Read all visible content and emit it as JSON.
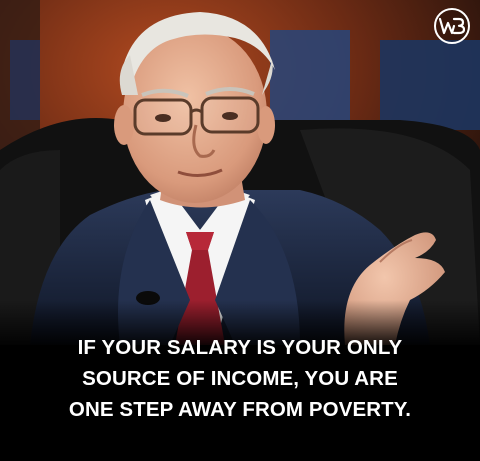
{
  "image": {
    "subject": "elderly man in glasses and dark suit with red tie seated in a black leather chair, gesturing with his left hand",
    "background_colors": [
      "#a0411c",
      "#1f3b6a",
      "#0d0d0d"
    ],
    "caption_color": "#ffffff",
    "logo_icon": "wb-monogram-circle-logo"
  },
  "caption": {
    "lines": [
      "IF YOUR SALARY IS YOUR ONLY",
      "SOURCE OF INCOME, YOU ARE",
      "ONE STEP AWAY FROM POVERTY."
    ]
  }
}
